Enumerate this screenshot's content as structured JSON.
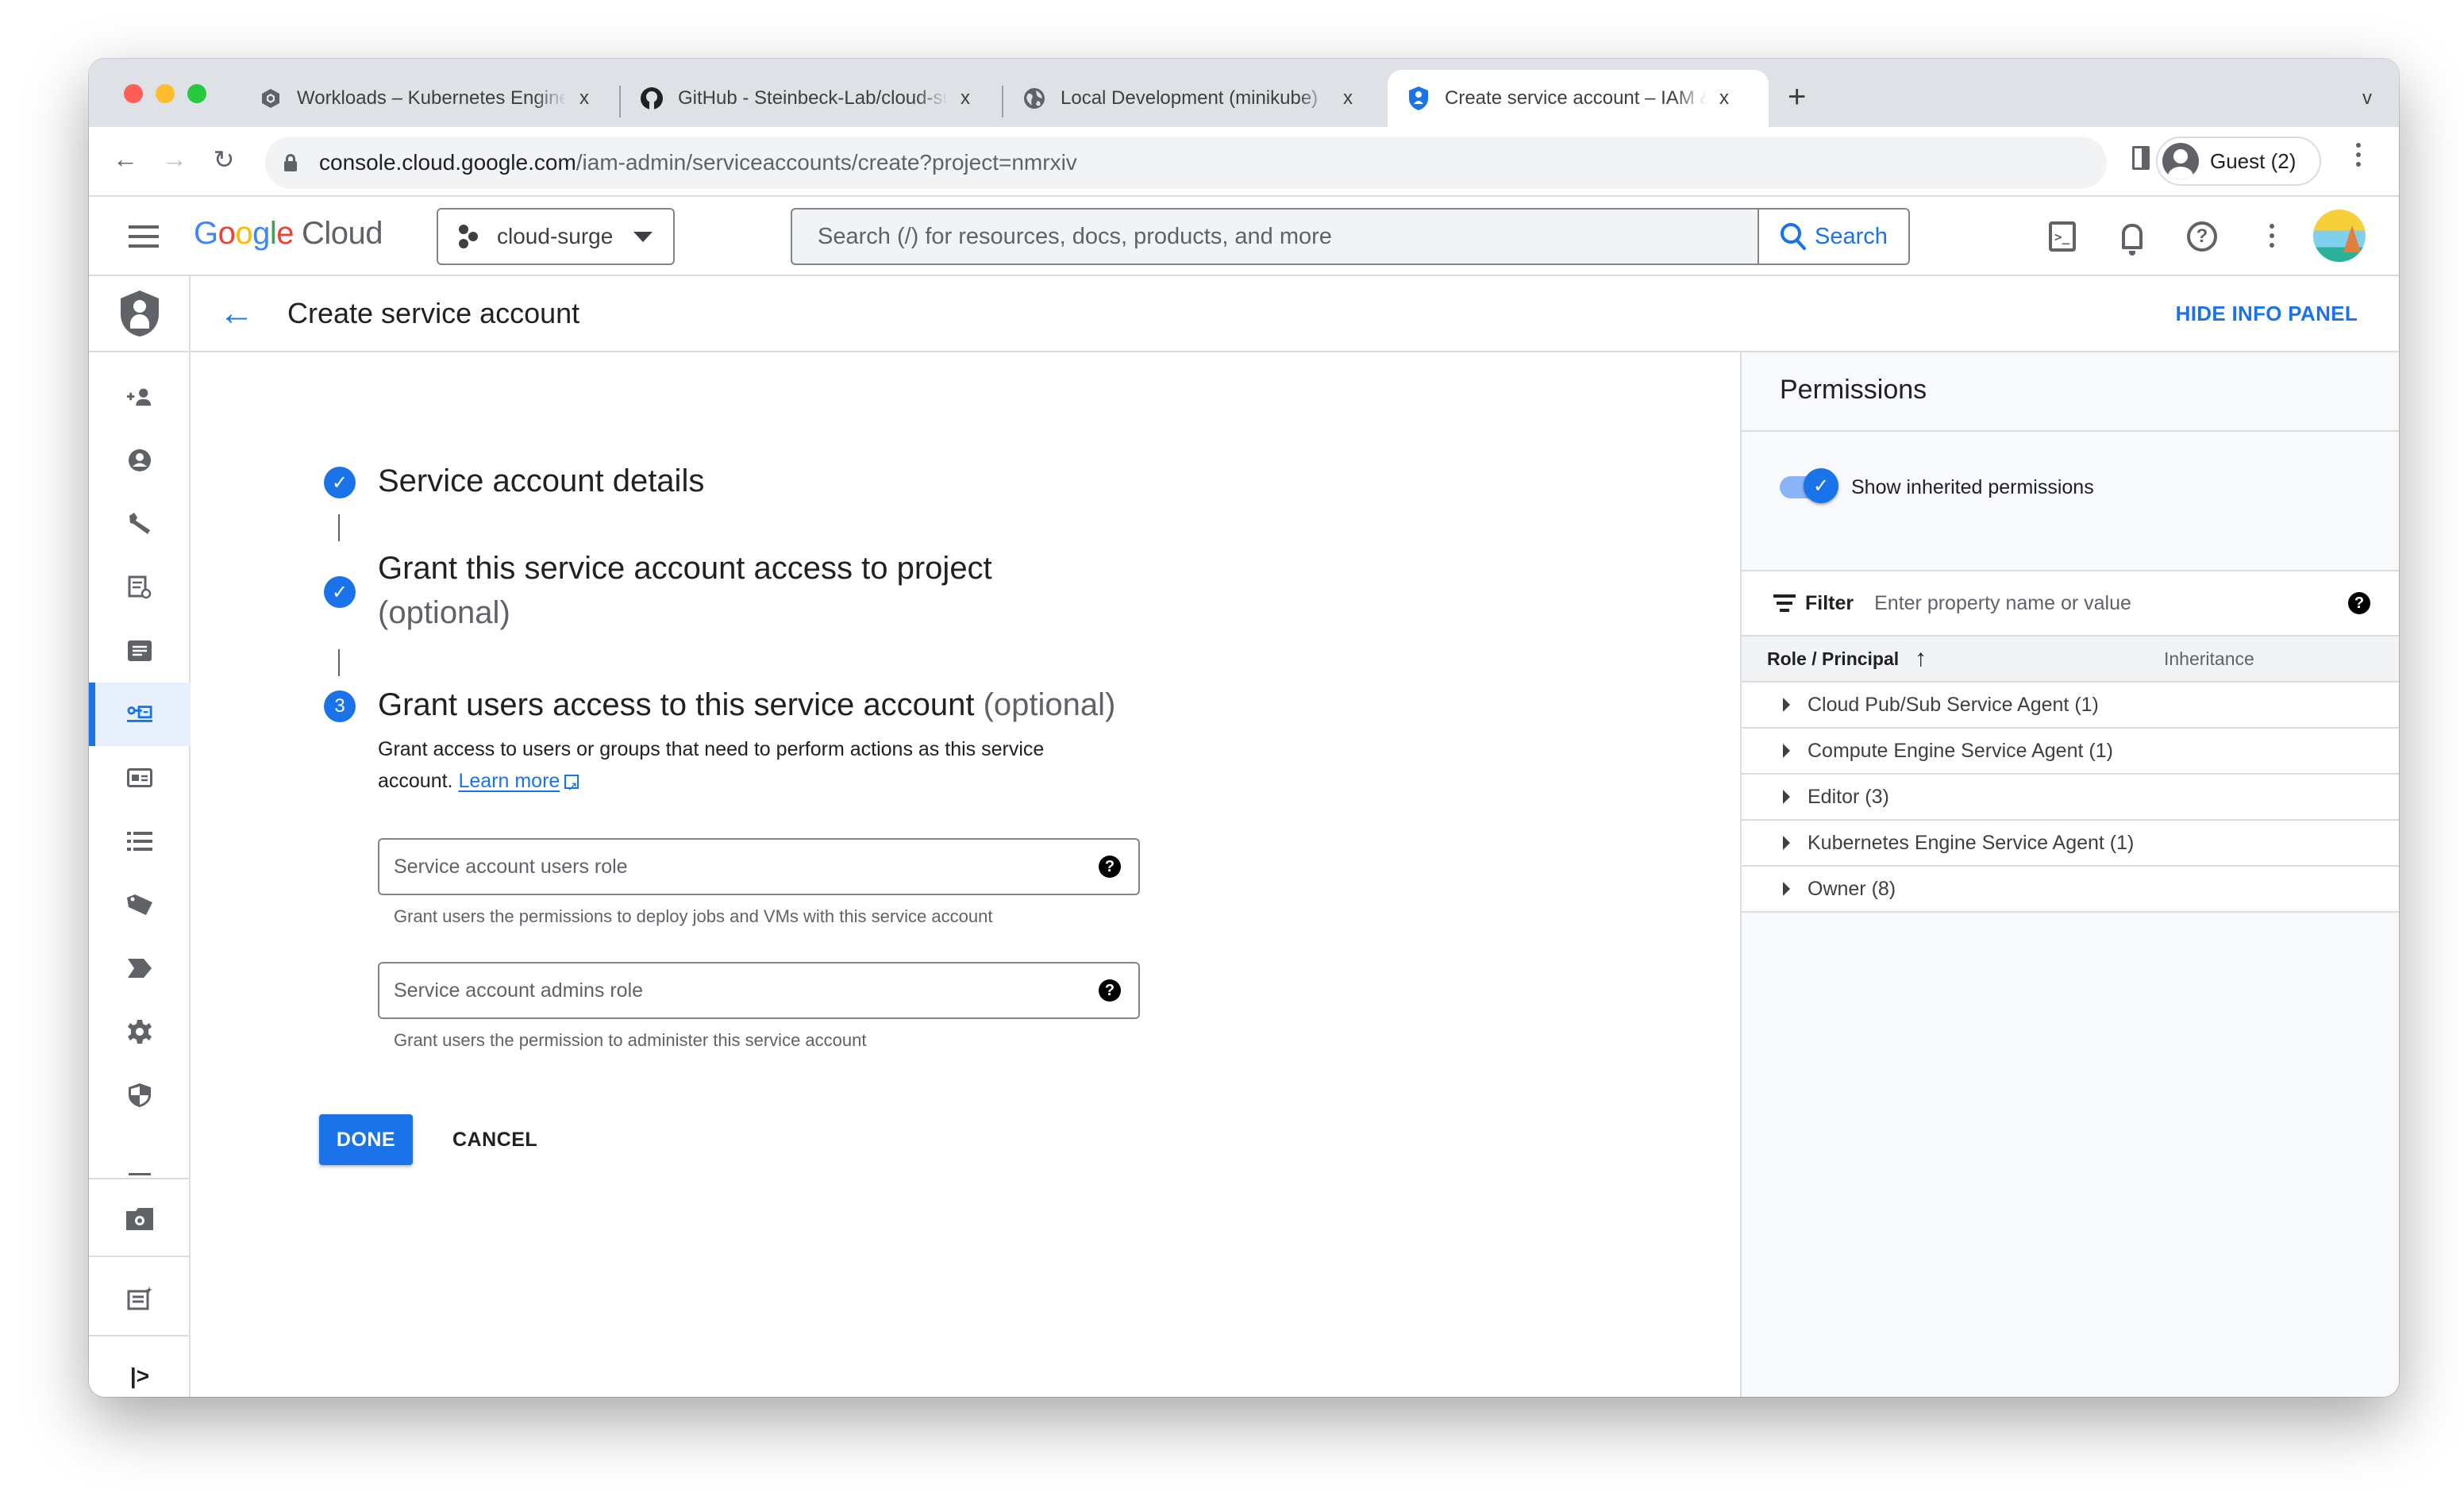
{
  "browser": {
    "tabs": [
      {
        "title": "Workloads – Kubernetes Engine",
        "icon": "kubernetes-engine-icon",
        "active": false
      },
      {
        "title": "GitHub - Steinbeck-Lab/cloud-surge",
        "icon": "github-icon",
        "active": false
      },
      {
        "title": "Local Development (minikube)",
        "icon": "globe-icon",
        "active": false
      },
      {
        "title": "Create service account – IAM & Admin",
        "icon": "iam-shield-icon",
        "active": true
      }
    ],
    "close_glyph": "x",
    "new_tab_glyph": "+",
    "tab_list_glyph": "v",
    "url_host": "console.cloud.google.com",
    "url_path": "/iam-admin/serviceaccounts/create?project=nmrxiv",
    "profile_label": "Guest (2)"
  },
  "header": {
    "logo_word": [
      "G",
      "o",
      "o",
      "g",
      "l",
      "e"
    ],
    "logo_product": "Cloud",
    "project_name": "cloud-surge",
    "search_placeholder": "Search (/) for resources, docs, products, and more",
    "search_button": "Search"
  },
  "rail": {
    "items": [
      {
        "icon": "person-add-icon",
        "active": false
      },
      {
        "icon": "account-circle-icon",
        "active": false
      },
      {
        "icon": "wrench-icon",
        "active": false
      },
      {
        "icon": "policy-doc-icon",
        "active": false
      },
      {
        "icon": "notes-icon",
        "active": false
      },
      {
        "icon": "service-account-key-icon",
        "active": true
      },
      {
        "icon": "id-card-icon",
        "active": false
      },
      {
        "icon": "list-icon",
        "active": false
      },
      {
        "icon": "tag-icon",
        "active": false
      },
      {
        "icon": "label-arrow-icon",
        "active": false
      },
      {
        "icon": "settings-gear-icon",
        "active": false
      },
      {
        "icon": "security-shield-icon",
        "active": false
      }
    ],
    "expand_glyph": "|>"
  },
  "page": {
    "title": "Create service account",
    "hide_info_panel": "HIDE INFO PANEL"
  },
  "steps": [
    {
      "state": "done",
      "title": "Service account details",
      "optional": ""
    },
    {
      "state": "done",
      "title": "Grant this service account access to project",
      "optional": "(optional)"
    },
    {
      "state": "current",
      "number": "3",
      "title": "Grant users access to this service account",
      "optional": "(optional)"
    }
  ],
  "step3": {
    "description": "Grant access to users or groups that need to perform actions as this service account.",
    "learn_more": "Learn more",
    "fields": [
      {
        "label": "Service account users role",
        "value": "",
        "hint": "Grant users the permissions to deploy jobs and VMs with this service account"
      },
      {
        "label": "Service account admins role",
        "value": "",
        "hint": "Grant users the permission to administer this service account"
      }
    ],
    "done_button": "DONE",
    "cancel_button": "CANCEL"
  },
  "info_panel": {
    "title": "Permissions",
    "toggle_label": "Show inherited permissions",
    "toggle_on": true,
    "filter_label": "Filter",
    "filter_placeholder": "Enter property name or value",
    "columns": {
      "role": "Role / Principal",
      "inheritance": "Inheritance"
    },
    "sort": "ascending",
    "rows": [
      {
        "label": "Cloud Pub/Sub Service Agent (1)"
      },
      {
        "label": "Compute Engine Service Agent (1)"
      },
      {
        "label": "Editor (3)"
      },
      {
        "label": "Kubernetes Engine Service Agent (1)"
      },
      {
        "label": "Owner (8)"
      }
    ]
  },
  "colors": {
    "accent": "#1a73e8",
    "toggle_track": "#8ab4f8",
    "border": "#dadce0"
  }
}
